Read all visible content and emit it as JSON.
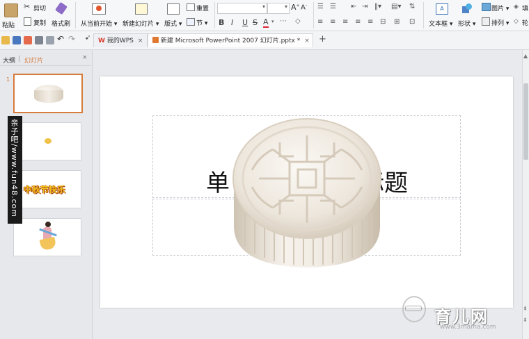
{
  "ribbon": {
    "paste": "粘贴",
    "cut": "剪切",
    "copy": "复制",
    "format_painter": "格式刷",
    "from_current": "从当前开始",
    "new_slide": "新建幻灯片",
    "layout": "版式",
    "reset": "重置",
    "section": "节",
    "textbox": "文本框",
    "shape": "形状",
    "picture": "图片",
    "arrange": "排列",
    "fill": "填",
    "outline": "轮",
    "bold": "B",
    "italic": "I",
    "underline": "U",
    "strike": "S",
    "font_color": "A"
  },
  "tabs": [
    {
      "label": "我的WPS",
      "close": "×"
    },
    {
      "label": "新建 Microsoft PowerPoint 2007 幻灯片.pptx *",
      "close": "×"
    }
  ],
  "new_tab": "+",
  "left_panel": {
    "outline_tab": "大纲",
    "slides_tab": "幻灯片",
    "slide_number": "1"
  },
  "slides": [
    {
      "index": 1,
      "content": "mooncake-image"
    },
    {
      "index": 2,
      "content": "small-flower-image"
    },
    {
      "index": 3,
      "content": "中秋节快乐"
    },
    {
      "index": 4,
      "content": "chang-e-image"
    }
  ],
  "slide": {
    "title_left": "单",
    "title_right": "标题"
  },
  "watermarks": {
    "vertical_left": "亲子吧/www.fun48.com",
    "bottom_right": "育儿网",
    "bottom_right_url": "www.3mama.com"
  },
  "colors": {
    "accent_orange": "#d67b3c",
    "wps_red": "#d73a2c"
  }
}
